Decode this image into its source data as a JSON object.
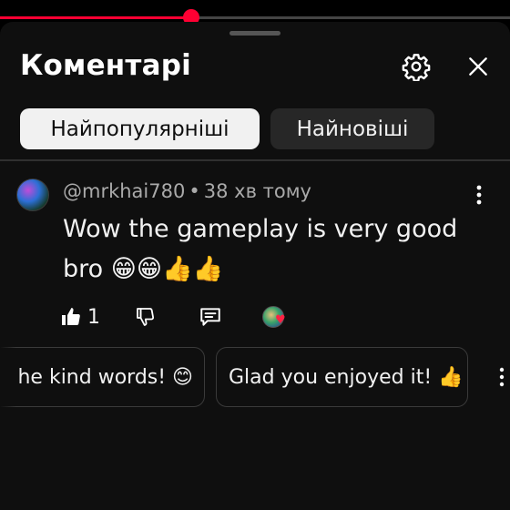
{
  "video": {
    "progress_percent": 37.5
  },
  "header": {
    "title": "Коментарі",
    "settings_icon": "gear-icon",
    "close_icon": "close-icon"
  },
  "tabs": [
    {
      "label": "Найпопулярніші",
      "selected": true
    },
    {
      "label": "Найновіші",
      "selected": false
    }
  ],
  "comment": {
    "author": "@mrkhai780",
    "separator": "•",
    "time": "38 хв тому",
    "text": "Wow the gameplay is very good bro 😁😁👍👍",
    "likes": "1"
  },
  "suggested_replies": [
    "he kind words! 😊",
    "Glad you enjoyed it! 👍"
  ],
  "colors": {
    "accent": "#ff0033",
    "sheet_bg": "#0f0f0f",
    "chip_active_bg": "#f1f1f1",
    "chip_bg": "#272727"
  }
}
